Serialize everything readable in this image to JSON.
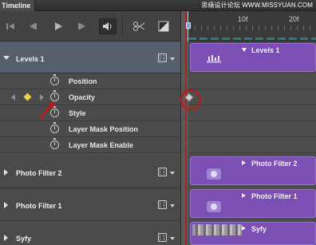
{
  "window": {
    "title": "Timeline",
    "watermark": "思缘设计论坛 WWW.MISSYUAN.COM"
  },
  "toolbar": {
    "buttons": [
      {
        "name": "go-to-first-frame",
        "icon": "skip-back-icon"
      },
      {
        "name": "previous-frame",
        "icon": "step-back-icon"
      },
      {
        "name": "play",
        "icon": "play-icon"
      },
      {
        "name": "next-frame",
        "icon": "step-forward-icon"
      },
      {
        "name": "mute-audio",
        "icon": "speaker-icon"
      },
      {
        "name": "split-at-playhead",
        "icon": "scissors-icon"
      },
      {
        "name": "transitions",
        "icon": "transition-icon"
      }
    ]
  },
  "ruler": {
    "ticks": [
      "10f",
      "20f"
    ]
  },
  "tracks": [
    {
      "name": "Levels 1",
      "expanded": true,
      "properties": [
        "Position",
        "Opacity",
        "Style",
        "Layer Mask Position",
        "Layer Mask Enable"
      ],
      "clip_label": "Levels 1"
    },
    {
      "name": "Photo Filter 2",
      "expanded": false,
      "clip_label": "Photo Filter 2"
    },
    {
      "name": "Photo Filter 1",
      "expanded": false,
      "clip_label": "Photo Filter 1"
    },
    {
      "name": "Syfy",
      "expanded": false,
      "clip_label": "Syfy"
    }
  ],
  "colors": {
    "clip_purple": "#7b4fb3",
    "selected_track": "#565f6b",
    "keyframe_yellow": "#e7d54a",
    "annotation_red": "#c01818"
  }
}
